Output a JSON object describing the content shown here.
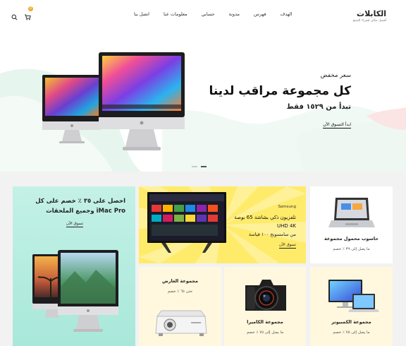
{
  "header": {
    "logo_title": "الكابلات",
    "logo_subtitle": "أفضل مكان لشراء المنتج",
    "nav": [
      "الهدف",
      "فهرس",
      "مدونة",
      "حسابي",
      "معلومات عنا",
      "اتصل بنا"
    ],
    "cart_count": "0",
    "icons": [
      "cart-icon",
      "search-icon"
    ]
  },
  "hero": {
    "kicker": "سعر مخفض",
    "title": "كل مجموعة مراقب لدينا",
    "price": "تبدأ من ١٥٢٩ فقط",
    "cta": "ابدأ التسوق الآن"
  },
  "promos": {
    "imac": {
      "title": "احصل على ٣٥ ٪ خصم على كل iMac Pro وجميع الملحقات",
      "link": "تسوق الآن"
    },
    "tv": {
      "brand": "Samsung",
      "title": "تلفزيون ذكي بشاشة 65 بوصة UHD 4K",
      "subtitle": "من سامسونج ١٠٠ قياسة",
      "link": "تسوق الآن"
    },
    "laptop": {
      "title": "حاسوب محمول مجموعة",
      "subtitle": "ما يصل إلى ٣٩ ٪ خصم"
    },
    "projector": {
      "title": "مجموعة العارض",
      "subtitle": "حتى ٦٥ ٪ خصم"
    },
    "camera": {
      "title": "مجموعة الكاميرا",
      "subtitle": "ما يصل إلى ٧٥ ٪ خصم"
    },
    "computer": {
      "title": "مجموعة الكمبيوتر",
      "subtitle": "ما يصل إلى ٧٥ ٪ خصم"
    }
  },
  "colors": {
    "tv_bg": "#ffeb6a",
    "imac_bg": "#b5ece0",
    "accent": "#f0a830",
    "tile_bg": "#fff8de"
  }
}
